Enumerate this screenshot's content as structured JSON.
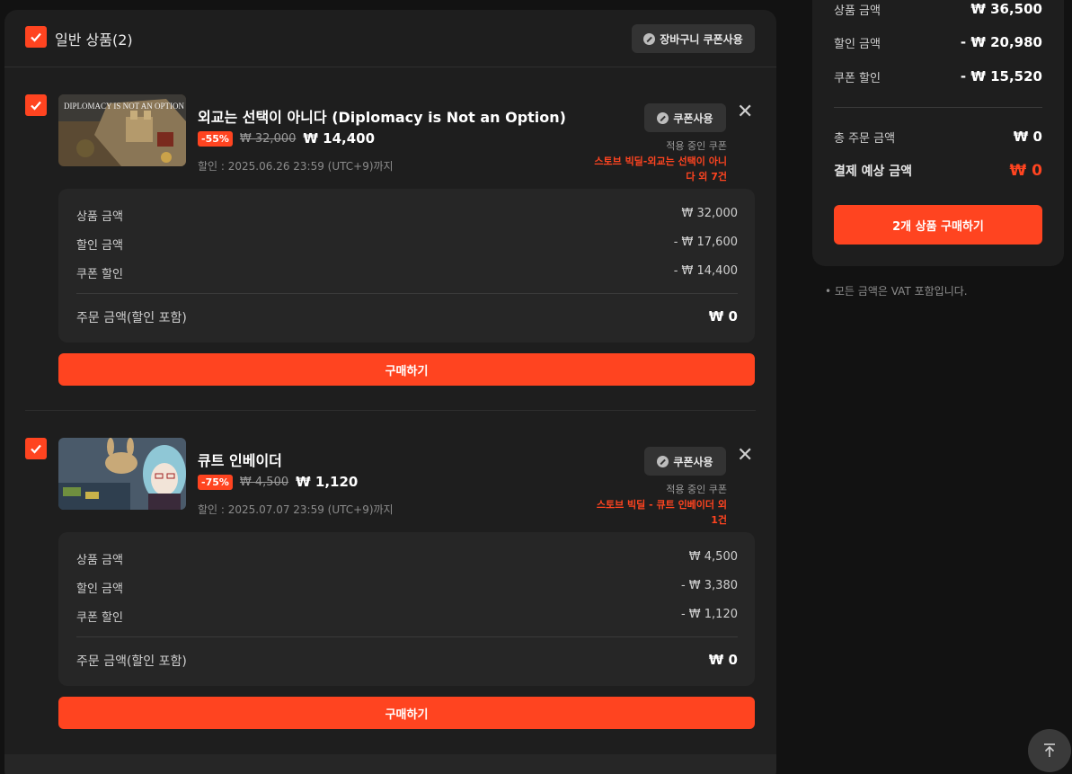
{
  "cart": {
    "title": "일반 상품(2)",
    "coupon_all_label": "장바구니 쿠폰사용"
  },
  "items": [
    {
      "title": "외교는 선택이 아니다 (Diplomacy is Not an Option)",
      "discount": "-55%",
      "original_price": "₩ 32,000",
      "final_price": "₩ 14,400",
      "until": "할인 : 2025.06.26 23:59 (UTC+9)까지",
      "coupon_label": "쿠폰사용",
      "applied_label": "적용 중인 쿠폰",
      "applied_coupon": "스토브 빅딜-외교는 선택이 아니다 외 7건",
      "thumb_logo": "DIPLOMACY IS NOT AN OPTION",
      "summary": {
        "product_label": "상품 금액",
        "product_value": "₩ 32,000",
        "discount_label": "할인 금액",
        "discount_value": "- ₩ 17,600",
        "coupon_label": "쿠폰 할인",
        "coupon_value": "- ₩ 14,400",
        "total_label": "주문 금액(할인 포함)",
        "total_value": "₩ 0"
      },
      "buy_label": "구매하기"
    },
    {
      "title": "큐트 인베이더",
      "discount": "-75%",
      "original_price": "₩ 4,500",
      "final_price": "₩ 1,120",
      "until": "할인 : 2025.07.07 23:59 (UTC+9)까지",
      "coupon_label": "쿠폰사용",
      "applied_label": "적용 중인 쿠폰",
      "applied_coupon": "스토브 빅딜 - 큐트 인베이더 외 1건",
      "summary": {
        "product_label": "상품 금액",
        "product_value": "₩ 4,500",
        "discount_label": "할인 금액",
        "discount_value": "- ₩ 3,380",
        "coupon_label": "쿠폰 할인",
        "coupon_value": "- ₩ 1,120",
        "total_label": "주문 금액(할인 포함)",
        "total_value": "₩ 0"
      },
      "buy_label": "구매하기"
    }
  ],
  "side": {
    "product_label": "상품 금액",
    "product_value": "₩ 36,500",
    "discount_label": "할인 금액",
    "discount_value": "- ₩ 20,980",
    "coupon_label": "쿠폰 할인",
    "coupon_value": "- ₩ 15,520",
    "total_label": "총 주문 금액",
    "total_value": "₩ 0",
    "expected_label": "결제 예상 금액",
    "expected_value": "₩ 0",
    "buy_label": "2개 상품 구매하기",
    "vat_note": "• 모든 금액은 VAT 포함입니다."
  },
  "colors": {
    "accent": "#ff4420",
    "panel": "#1e1e1e",
    "background": "#121212"
  },
  "icons": [
    "check-icon",
    "coupon-icon",
    "close-icon",
    "arrow-up-icon"
  ]
}
